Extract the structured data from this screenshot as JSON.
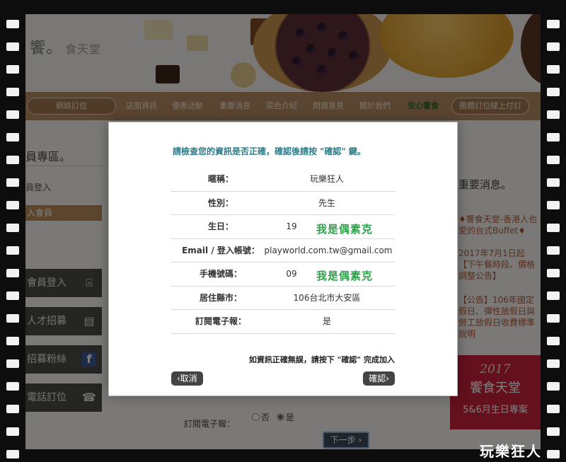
{
  "site": {
    "logo": "饗。",
    "logo_sub": "食天堂"
  },
  "nav": {
    "online_order": "網路訂位",
    "items": [
      "店面資訊",
      "優惠活動",
      "重要消息",
      "菜色介紹",
      "問題意見",
      "關於我們"
    ],
    "highlight": "安心饗食",
    "group_order": "團體訂位線上付訂"
  },
  "sidebar": {
    "title": "員專區。",
    "links": [
      "員登入",
      "入會員"
    ],
    "buttons": [
      {
        "label": "會員登入",
        "icon": "user-lock-icon",
        "glyph": "⍓"
      },
      {
        "label": "人才招募",
        "icon": "id-card-icon",
        "glyph": "▤"
      },
      {
        "label": "招募粉絲",
        "icon": "facebook-icon",
        "glyph": "f"
      },
      {
        "label": "電話訂位",
        "icon": "phone-icon",
        "glyph": "☎"
      }
    ]
  },
  "right": {
    "title": "重要消息。",
    "news": [
      "♦饗食天堂-香港人也愛的台式Buffet♦",
      "2017年7月1日起【下午餐時段、價格調整公告】",
      "【公告】106年國定假日、彈性放假日與勞工放假日收費標準說明"
    ],
    "promo": {
      "year": "2017",
      "name": "饗食天堂",
      "sub": "5&6月生日專案"
    }
  },
  "form_bg": {
    "newsletter_label": "訂閱電子報：",
    "radio_no": "否",
    "radio_yes": "是",
    "next": "下一步 ›"
  },
  "modal": {
    "heading": "請檢查您的資訊是否正確，確認後請按 \"確認\" 鍵。",
    "rows": [
      {
        "label": "暱稱：",
        "value": "玩樂狂人"
      },
      {
        "label": "性別：",
        "value": "先生"
      },
      {
        "label": "生日：",
        "value": "19"
      },
      {
        "label": "Email / 登入帳號：",
        "value": "playworld.com.tw@gmail.com"
      },
      {
        "label": "手機號碼：",
        "value": "09"
      },
      {
        "label": "居住縣市：",
        "value": "106台北市大安區"
      },
      {
        "label": "訂閱電子報：",
        "value": "是"
      }
    ],
    "note": "如資訊正確無誤，請按下 \"確認\" 完成加入",
    "cancel": "‹取消",
    "confirm": "確認›"
  },
  "watermark": "我是偶素克",
  "signature": "玩樂狂人"
}
